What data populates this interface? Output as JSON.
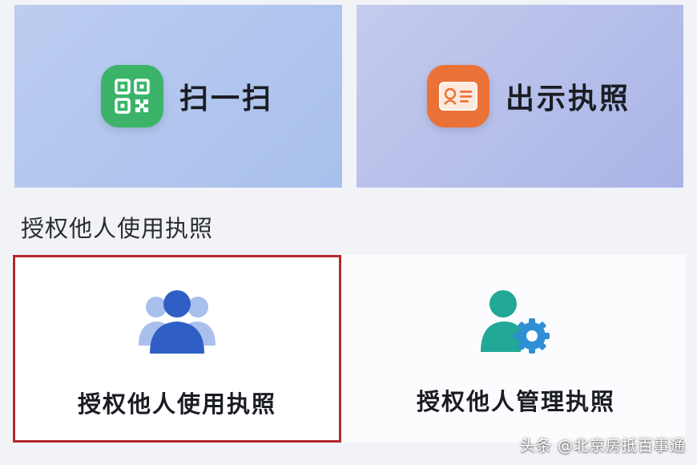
{
  "actions": {
    "scan_label": "扫一扫",
    "show_license_label": "出示执照"
  },
  "section": {
    "title": "授权他人使用执照"
  },
  "cards": {
    "authorize_use_label": "授权他人使用执照",
    "authorize_manage_label": "授权他人管理执照"
  },
  "watermark": {
    "text": "头条 @北京房抵百事通"
  },
  "icons": {
    "scan": "qr-code-icon",
    "license": "id-card-icon",
    "use": "users-group-icon",
    "manage": "user-settings-icon"
  },
  "colors": {
    "scan_icon_bg": "#3bb46a",
    "license_icon_bg": "#eb7236",
    "use_icon": "#2f5fc4",
    "manage_icon": "#21a896",
    "highlight_border": "#b4282c"
  }
}
